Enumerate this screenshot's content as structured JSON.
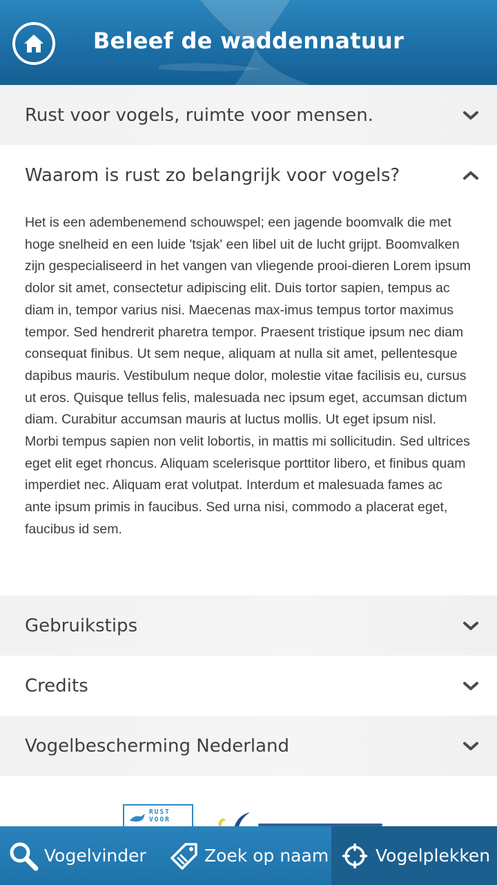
{
  "header": {
    "title": "Beleef de waddennatuur",
    "home_icon": "home-icon"
  },
  "accordion": {
    "sections": [
      {
        "title": "Rust voor vogels, ruimte voor mensen.",
        "expanded": false
      },
      {
        "title": "Waarom is rust zo belangrijk voor vogels?",
        "expanded": true,
        "body": "Het is een adembenemend schouwspel; een jagende boomvalk die met hoge snelheid en een luide 'tsjak' een libel uit de lucht grijpt. Boomvalken zijn gespecialiseerd in het vangen van vliegende prooi-dieren Lorem ipsum dolor sit amet, consectetur adipiscing elit. Duis tortor sapien, tempus ac diam in, tempor varius nisi. Maecenas max-imus tempus tortor maximus tempor. Sed hendrerit pharetra tempor. Praesent tristique ipsum nec diam consequat finibus. Ut sem neque, aliquam at nulla sit amet, pellentesque dapibus mauris. Vestibulum neque dolor, molestie vitae facilisis eu, cursus ut eros. Quisque tellus felis, malesuada nec ipsum eget, accumsan dictum diam. Curabitur accumsan mauris at luctus mollis. Ut eget ipsum nisl. Morbi tempus sapien non velit lobortis, in mattis mi sollicitudin. Sed ultrices eget elit eget rhoncus. Aliquam scelerisque porttitor libero, et finibus quam imperdiet nec. Aliquam erat volutpat. Interdum et malesuada fames ac ante ipsum primis in faucibus. Sed urna nisi, commodo a placerat eget, faucibus id sem."
      },
      {
        "title": "Gebruikstips",
        "expanded": false
      },
      {
        "title": "Credits",
        "expanded": false
      },
      {
        "title": "Vogelbescherming Nederland",
        "expanded": false
      }
    ]
  },
  "logos": {
    "rust_voor_vogels": "RUST VOOR"
  },
  "bottom_nav": {
    "items": [
      {
        "label": "Vogelvinder",
        "icon": "search-icon"
      },
      {
        "label": "Zoek op naam",
        "icon": "tag-icon"
      },
      {
        "label": "Vogelplekken",
        "icon": "crosshair-icon",
        "active": true
      }
    ]
  },
  "colors": {
    "header_blue": "#1c6fa7",
    "nav_blue": "#2378b0",
    "nav_active": "#1b5f8f",
    "shaded_row": "#f2f2f2"
  }
}
